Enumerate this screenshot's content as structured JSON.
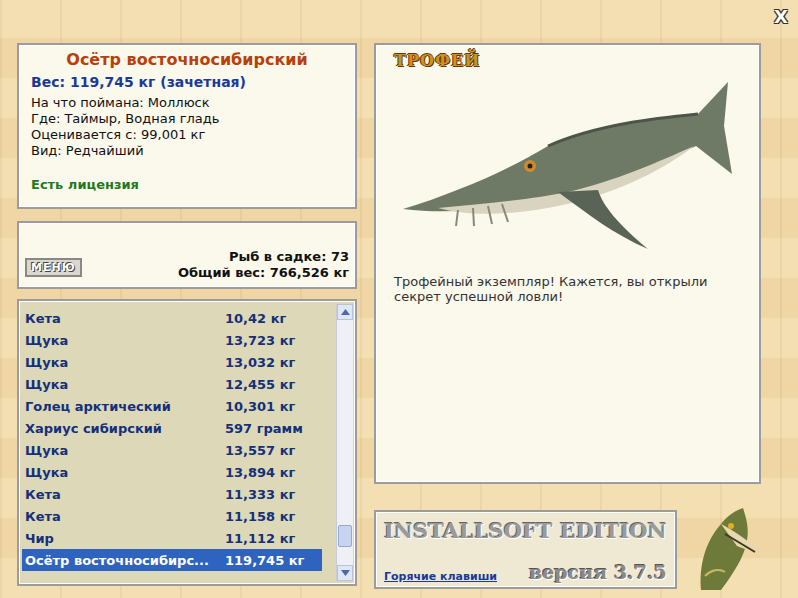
{
  "close": "X",
  "catch": {
    "title": "Осётр восточносибирский",
    "weight": "Вес: 119,745 кг (зачетная)",
    "details": [
      "На что поймана: Моллюск",
      "Где: Таймыр, Водная гладь",
      "Оценивается с: 99,001 кг",
      "Вид: Редчайший"
    ],
    "license": "Есть лицензия"
  },
  "summary": {
    "menu": "МЕНЮ",
    "count": "Рыб в садке: 73",
    "total": "Общий вес: 766,526 кг"
  },
  "list": {
    "scroll_level": 0.92,
    "rows": [
      {
        "name": "Кета",
        "weight": "10,42 кг",
        "selected": false
      },
      {
        "name": "Щука",
        "weight": "13,723 кг",
        "selected": false
      },
      {
        "name": "Щука",
        "weight": "13,032 кг",
        "selected": false
      },
      {
        "name": "Щука",
        "weight": "12,455 кг",
        "selected": false
      },
      {
        "name": "Голец арктический",
        "weight": "10,301 кг",
        "selected": false
      },
      {
        "name": "Хариус сибирский",
        "weight": "597 грамм",
        "selected": false
      },
      {
        "name": "Щука",
        "weight": "13,557 кг",
        "selected": false
      },
      {
        "name": "Щука",
        "weight": "13,894 кг",
        "selected": false
      },
      {
        "name": "Кета",
        "weight": "11,333 кг",
        "selected": false
      },
      {
        "name": "Кета",
        "weight": "11,158 кг",
        "selected": false
      },
      {
        "name": "Чир",
        "weight": "11,112 кг",
        "selected": false
      },
      {
        "name": "Осётр восточносибирс...",
        "weight": "119,745 кг",
        "selected": true
      }
    ]
  },
  "trophy": {
    "heading": "ТРОФЕЙ",
    "caption": "Трофейный экземпляр! Кажется, вы открыли секрет успешной ловли!"
  },
  "footer": {
    "edition": "INSTALLSOFT EDITION",
    "hotkeys": "Горячие клавиши",
    "version": "версия 3.7.5"
  }
}
